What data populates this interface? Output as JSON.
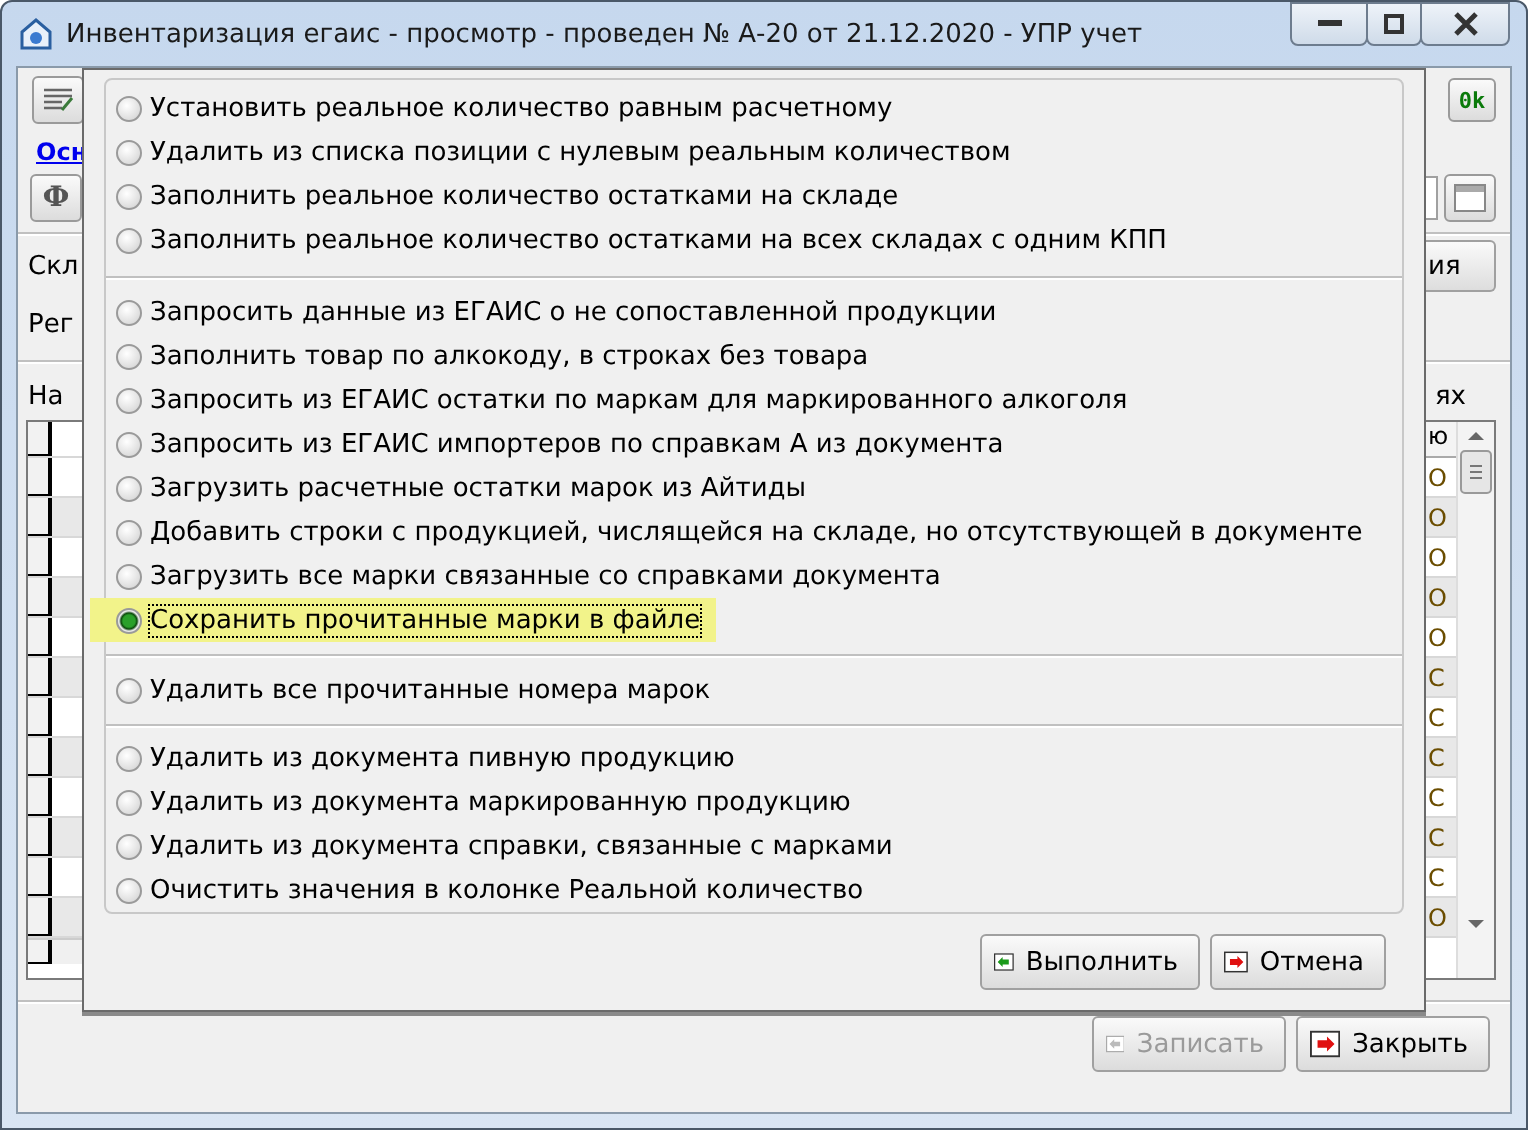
{
  "window": {
    "title": "Инвентаризация егаис - просмотр - проведен № А-20 от 21.12.2020 - УПР учет"
  },
  "background": {
    "ok_button": "0k",
    "link": "Осн",
    "f_button": "Ф",
    "labels": [
      "Скл",
      "Рег"
    ],
    "right_button": "ия",
    "list_label": "На",
    "list_label_right": "ях",
    "grid": {
      "header": "ю",
      "cells": [
        "О",
        "О",
        "О",
        "О",
        "О",
        "С",
        "С",
        "С",
        "С",
        "С",
        "С",
        "О"
      ]
    },
    "footer_buttons": [
      {
        "label": "Записать",
        "kind": "save",
        "disabled": true
      },
      {
        "label": "Закрыть",
        "kind": "close",
        "disabled": false
      }
    ]
  },
  "dialog": {
    "groups": [
      {
        "options": [
          {
            "label": "Установить реальное количество равным расчетному",
            "selected": false
          },
          {
            "label": "Удалить из списка позиции с нулевым реальным количеством",
            "selected": false
          },
          {
            "label": "Заполнить реальное количество остатками на складе",
            "selected": false
          },
          {
            "label": "Заполнить реальное количество остатками на всех складах с одним КПП",
            "selected": false
          }
        ]
      },
      {
        "options": [
          {
            "label": "Запросить данные из ЕГАИС о не сопоставленной продукции",
            "selected": false
          },
          {
            "label": "Заполнить товар по алкокоду, в строках без товара",
            "selected": false
          },
          {
            "label": "Запросить из ЕГАИС остатки по маркам для маркированного алкоголя",
            "selected": false
          },
          {
            "label": "Запросить из ЕГАИС импортеров по справкам А из документа",
            "selected": false
          },
          {
            "label": "Загрузить расчетные остатки марок из Айтиды",
            "selected": false
          },
          {
            "label": "Добавить строки с продукцией, числящейся на складе, но отсутствующей в документе",
            "selected": false
          },
          {
            "label": "Загрузить все марки связанные со справками документа",
            "selected": false
          },
          {
            "label": "Сохранить прочитанные марки в файле",
            "selected": true
          }
        ]
      },
      {
        "options": [
          {
            "label": "Удалить все прочитанные номера марок",
            "selected": false
          }
        ]
      },
      {
        "options": [
          {
            "label": "Удалить из документа пивную продукцию",
            "selected": false
          },
          {
            "label": "Удалить из документа маркированную продукцию",
            "selected": false
          },
          {
            "label": "Удалить из документа справки, связанные с марками",
            "selected": false
          },
          {
            "label": "Очистить значения в колонке Реальной количество",
            "selected": false
          }
        ]
      }
    ],
    "buttons": [
      {
        "label": "Выполнить",
        "kind": "run"
      },
      {
        "label": "Отмена",
        "kind": "cancel"
      }
    ]
  }
}
